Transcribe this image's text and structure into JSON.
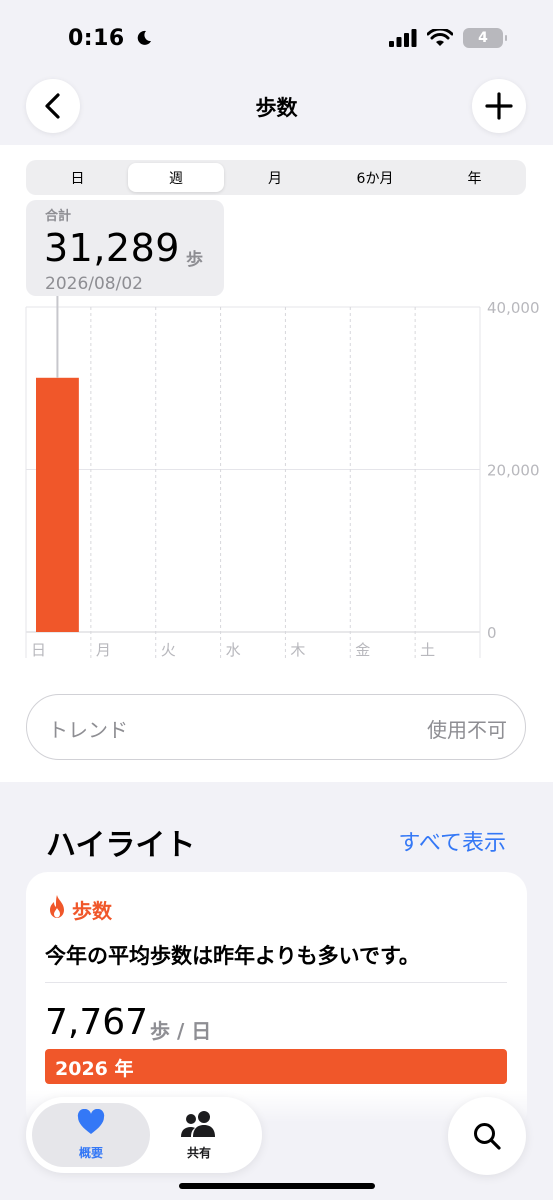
{
  "status": {
    "time": "0:16",
    "battery": "4"
  },
  "nav": {
    "title": "歩数"
  },
  "segments": [
    "日",
    "週",
    "月",
    "6か月",
    "年"
  ],
  "active_segment": "週",
  "summary": {
    "label": "合計",
    "value": "31,289",
    "unit": "歩",
    "date": "2026/08/02"
  },
  "chart_data": {
    "type": "bar",
    "categories": [
      "日",
      "月",
      "火",
      "水",
      "木",
      "金",
      "土"
    ],
    "values": [
      31289,
      0,
      0,
      0,
      0,
      0,
      0
    ],
    "y_ticks": [
      "40,000",
      "20,000",
      "0"
    ],
    "ylim": [
      0,
      40000
    ],
    "grid": true,
    "color": "#f0572a"
  },
  "trend": {
    "label": "トレンド",
    "value": "使用不可"
  },
  "highlights": {
    "title": "ハイライト",
    "link": "すべて表示",
    "card": {
      "category": "歩数",
      "text": "今年の平均歩数は昨年よりも多いです。",
      "number": "7,767",
      "unit": "歩 / 日",
      "bar_label": "2026 年"
    }
  },
  "tabbar": {
    "overview": "概要",
    "sharing": "共有"
  },
  "colors": {
    "accent": "#f0572a",
    "link": "#3478f6",
    "tab_active": "#3478f6"
  }
}
